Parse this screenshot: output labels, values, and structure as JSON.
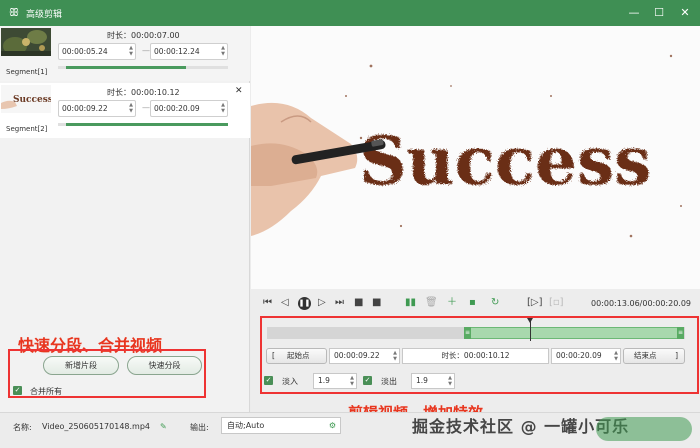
{
  "window": {
    "title": "高级剪辑",
    "controls": [
      "—",
      "☐",
      "✕"
    ]
  },
  "segments": [
    {
      "label": "Segment[1]",
      "duration": "时长：00:00:07.00",
      "start": "00:00:05.24",
      "end": "00:00:12.24",
      "progress": [
        0.05,
        0.75
      ],
      "thumbnail_text": ""
    },
    {
      "label": "Segment[2]",
      "duration": "时长：00:00:10.12",
      "start": "00:00:09.22",
      "end": "00:00:20.09",
      "progress": [
        0.05,
        1.0
      ],
      "thumbnail_text": "Success"
    }
  ],
  "left_annotation": "快速分段、合并视频",
  "left_buttons": {
    "add_segment": "新增片段",
    "quick_split": "快速分段"
  },
  "merge_all": {
    "label": "合并所有",
    "checked": true
  },
  "preview_text": "Success",
  "player": {
    "timecode": "00:00:13.06/00:00:20.09"
  },
  "trim": {
    "selection": [
      0.475,
      1.0
    ],
    "playhead": 0.63,
    "start_button": "起始点",
    "start_time": "00:00:09.22",
    "duration": "时长：00:00:10.12",
    "end_time": "00:00:20.09",
    "end_button": "结束点",
    "fade_in_label": "淡入",
    "fade_in_value": "1.9",
    "fade_out_label": "淡出",
    "fade_out_value": "1.9"
  },
  "right_annotation": "剪辑视频、增加特效",
  "bottom": {
    "name_label": "名称:",
    "file_name": "Video_250605170148.mp4",
    "output_label": "输出:",
    "output_value": "自动;Auto"
  },
  "watermark": "掘金技术社区 @ 一罐小可乐",
  "colors": {
    "titlebar": "#3f8f54",
    "accent_green": "#4a9a5e",
    "annotation_red": "#e8361f"
  }
}
